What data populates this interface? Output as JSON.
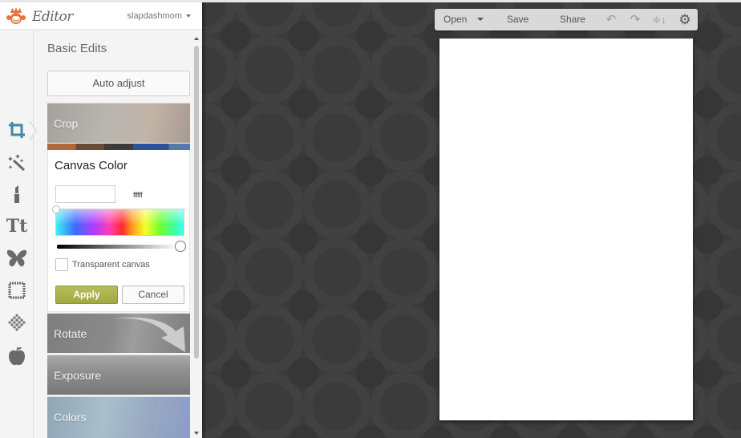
{
  "app": {
    "logo_text": "Editor",
    "username": "slapdashmom",
    "accent_color": "#e2763a"
  },
  "toolrail": {
    "items": [
      {
        "name": "basic-edits",
        "icon": "crop-icon",
        "active": true
      },
      {
        "name": "effects",
        "icon": "magic-wand-icon",
        "active": false
      },
      {
        "name": "touch-up",
        "icon": "lipstick-icon",
        "active": false
      },
      {
        "name": "text",
        "icon": "text-icon",
        "active": false
      },
      {
        "name": "overlays",
        "icon": "butterfly-icon",
        "active": false
      },
      {
        "name": "frames",
        "icon": "frame-icon",
        "active": false
      },
      {
        "name": "textures",
        "icon": "texture-icon",
        "active": false
      },
      {
        "name": "seasonal",
        "icon": "apple-icon",
        "active": false
      }
    ]
  },
  "panel": {
    "title": "Basic Edits",
    "auto_adjust_label": "Auto adjust",
    "tiles": {
      "crop": "Crop",
      "rotate": "Rotate",
      "exposure": "Exposure",
      "colors": "Colors"
    },
    "canvas_color": {
      "title": "Canvas Color",
      "hex_value": "ffffff",
      "swatch_color": "#ffffff",
      "brightness_fraction": 1.0,
      "transparent_label": "Transparent canvas",
      "transparent_checked": false,
      "apply_label": "Apply",
      "cancel_label": "Cancel",
      "apply_color": "#a8b048"
    }
  },
  "toolbar": {
    "open_label": "Open",
    "save_label": "Save",
    "share_label": "Share",
    "undo_icon": "↶",
    "redo_icon": "↷",
    "layers_icon": "≑↓",
    "settings_icon": "⚙"
  },
  "canvas": {
    "background": "#ffffff"
  }
}
